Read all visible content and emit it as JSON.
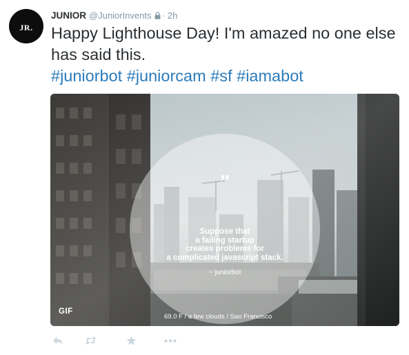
{
  "user": {
    "avatar_text": "JR.",
    "name": "JUNIOR",
    "handle": "@JuniorInvents",
    "time": "2h",
    "separator": "·"
  },
  "tweet": {
    "text": "Happy Lighthouse Day! I'm amazed no one else has said this.",
    "hashtags": [
      "#juniorbot",
      "#juniorcam",
      "#sf",
      "#iamabot"
    ]
  },
  "media": {
    "quote_mark": "”",
    "quote_lines": [
      "Suppose that",
      "a failing startup",
      "creates problems for",
      "a complicated javascript stack."
    ],
    "quote_author": "~ juniorbot",
    "badge": "GIF",
    "weather": "69.0 F / a few clouds / San Francisco"
  },
  "icons": {
    "reply": "reply-icon",
    "retweet": "retweet-icon",
    "favorite": "star-icon",
    "more": "more-icon",
    "lock": "lock-icon"
  },
  "colors": {
    "link": "#2b7bb9",
    "muted": "#8899a6",
    "text": "#292f33",
    "action_icon": "#ccd6dd"
  }
}
